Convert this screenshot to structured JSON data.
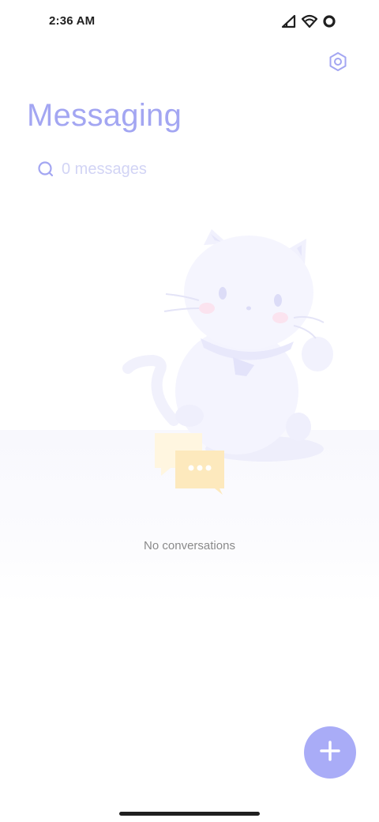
{
  "status_bar": {
    "time": "2:36 AM",
    "icons": [
      "cellular-signal-icon",
      "wifi-icon",
      "circle-status-icon"
    ]
  },
  "header": {
    "title": "Messaging",
    "settings_icon": "settings-hexagon-icon"
  },
  "search": {
    "icon": "search-icon",
    "text": "0 messages"
  },
  "empty_state": {
    "illustration": "cat-illustration",
    "message": "No conversations"
  },
  "fab": {
    "icon": "plus-icon"
  },
  "colors": {
    "accent": "#a9acf7",
    "title": "#a3a6f2",
    "search_text": "#d2d4f5",
    "empty_text": "#8a8a8a"
  }
}
